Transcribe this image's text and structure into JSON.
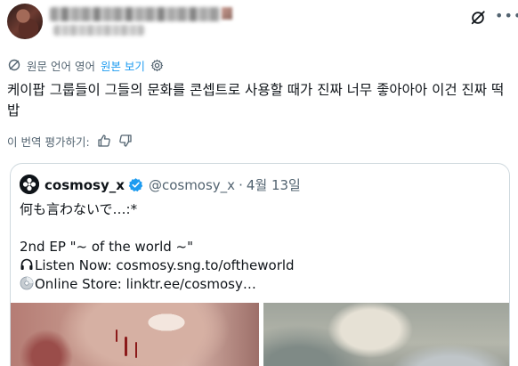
{
  "header": {
    "display_name": "",
    "handle": ""
  },
  "translation": {
    "label": "원문 언어 영어",
    "show_original": "원본 보기"
  },
  "tweet": {
    "text": "케이팝 그룹들이 그들의 문화를 콘셉트로 사용할 때가 진짜 너무 좋아아아 이건 진짜 떡밥"
  },
  "rate": {
    "label": "이 번역 평가하기:"
  },
  "quote": {
    "name": "cosmosy_x",
    "handle": "@cosmosy_x",
    "dot": "·",
    "date": "4월 13일",
    "lines": {
      "l1": "何も言わないで…:*",
      "l2": "2nd EP \"~ of the world ~\"",
      "l3": "Listen Now: cosmosy.sng.to/oftheworld",
      "l4": "Online Store: linktr.ee/cosmosy…"
    }
  },
  "icons": {
    "grok": "grok-icon",
    "more": "more-icon",
    "translate": "translate-icon",
    "settings": "gear-icon",
    "thumbs_up": "thumbs-up-icon",
    "thumbs_down": "thumbs-down-icon",
    "verified": "verified-badge-icon",
    "headphones": "headphones-icon",
    "disc": "disc-icon"
  },
  "colors": {
    "accent": "#1d9bf0",
    "text": "#0f1419",
    "muted": "#536471",
    "border": "#cfd9de"
  }
}
